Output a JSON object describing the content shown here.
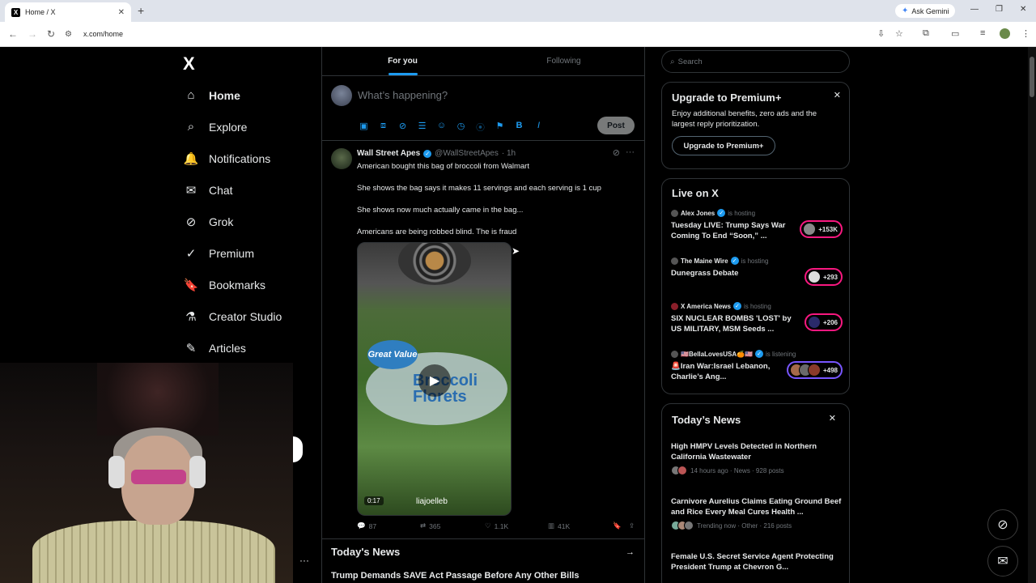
{
  "browser": {
    "tab_title": "Home / X",
    "tab_favicon": "X",
    "new_tab": "+",
    "gemini_label": "Ask Gemini",
    "url": "x.com/home"
  },
  "sidebar": {
    "logo": "X",
    "items": [
      {
        "label": "Home",
        "icon": "⌂"
      },
      {
        "label": "Explore",
        "icon": "⌕"
      },
      {
        "label": "Notifications",
        "icon": "🔔"
      },
      {
        "label": "Chat",
        "icon": "✉"
      },
      {
        "label": "Grok",
        "icon": "⊘"
      },
      {
        "label": "Premium",
        "icon": "✓"
      },
      {
        "label": "Bookmarks",
        "icon": "🔖"
      },
      {
        "label": "Creator Studio",
        "icon": "⚗"
      },
      {
        "label": "Articles",
        "icon": "✎"
      }
    ],
    "more": "···"
  },
  "feed": {
    "tabs": [
      "For you",
      "Following"
    ],
    "composer_placeholder": "What’s happening?",
    "post_button": "Post",
    "tweet": {
      "name": "Wall Street Apes",
      "handle": "@WallStreetApes",
      "time": "· 1h",
      "lines": [
        "American bought this bag of broccoli from Walmart",
        "She shows the bag says it makes 11 servings and each serving is 1 cup",
        "She shows now much actually came in the bag...",
        "Americans are being robbed blind. The is fraud"
      ],
      "video": {
        "brand": "Great Value",
        "product": "Broccoli Florets",
        "duration": "0:17",
        "watermark": "liajoelleb"
      },
      "stats": {
        "replies": "87",
        "reposts": "365",
        "likes": "1.1K",
        "views": "41K"
      }
    },
    "todays_news_heading": "Today's News",
    "news_first_item": "Trump Demands SAVE Act Passage Before Any Other Bills"
  },
  "right": {
    "search_placeholder": "Search",
    "premium": {
      "title": "Upgrade to Premium+",
      "description": "Enjoy additional benefits, zero ads and the largest reply prioritization.",
      "button": "Upgrade to Premium+"
    },
    "live": {
      "title": "Live on X",
      "items": [
        {
          "host": "Alex Jones",
          "status": "is hosting",
          "title": "Tuesday LIVE: Trump Says War Coming To End “Soon,” ...",
          "count": "+153K",
          "pill": "pink"
        },
        {
          "host": "The Maine Wire",
          "status": "is hosting",
          "title": "Dunegrass Debate",
          "count": "+293",
          "pill": "pink"
        },
        {
          "host": "X America News",
          "status": "is hosting",
          "title": "SIX NUCLEAR BOMBS 'LOST' by US MILITARY, MSM Seeds ...",
          "count": "+206",
          "pill": "pink"
        },
        {
          "host": "🇺🇸BellaLovesUSA🍊🇺🇸",
          "status": "is listening",
          "title": "🚨Iran War:Israel Lebanon, Charlie’s Ang...",
          "count": "+498",
          "pill": "purple"
        }
      ]
    },
    "news": {
      "title": "Today’s News",
      "items": [
        {
          "title": "High HMPV Levels Detected in Northern California Wastewater",
          "meta": "14 hours ago · News · 928 posts"
        },
        {
          "title": "Carnivore Aurelius Claims Eating Ground Beef and Rice Every Meal Cures Health ...",
          "meta": "Trending now · Other · 216 posts"
        },
        {
          "title": "Female U.S. Secret Service Agent Protecting President Trump at Chevron G...",
          "meta": ""
        }
      ]
    }
  },
  "colors": {
    "accent": "#1d9bf0",
    "live_pink": "#f91880",
    "live_purple": "#7856ff",
    "background": "#000000"
  }
}
